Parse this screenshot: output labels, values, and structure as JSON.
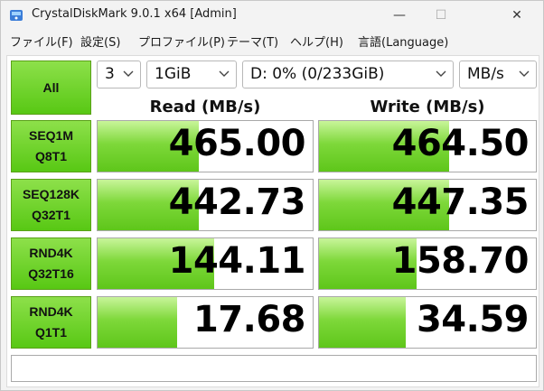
{
  "window": {
    "title": "CrystalDiskMark 9.0.1 x64 [Admin]",
    "controls": {
      "minimize": "—",
      "maximize": "☐",
      "close": "✕"
    }
  },
  "menu": [
    "ファイル(F)",
    "設定(S)",
    "プロファイル(P)",
    "テーマ(T)",
    "ヘルプ(H)",
    "言語(Language)"
  ],
  "toolbar": {
    "all_label": "All",
    "count": "3",
    "size": "1GiB",
    "drive": "D: 0% (0/233GiB)",
    "unit": "MB/s"
  },
  "headers": {
    "read": "Read (MB/s)",
    "write": "Write (MB/s)"
  },
  "tests": [
    {
      "line1": "SEQ1M",
      "line2": "Q8T1",
      "read": "465.00",
      "write": "464.50",
      "read_fill": 0.47,
      "write_fill": 0.6
    },
    {
      "line1": "SEQ128K",
      "line2": "Q32T1",
      "read": "442.73",
      "write": "447.35",
      "read_fill": 0.47,
      "write_fill": 0.6
    },
    {
      "line1": "RND4K",
      "line2": "Q32T16",
      "read": "144.11",
      "write": "158.70",
      "read_fill": 0.54,
      "write_fill": 0.45
    },
    {
      "line1": "RND4K",
      "line2": "Q1T1",
      "read": "17.68",
      "write": "34.59",
      "read_fill": 0.37,
      "write_fill": 0.4
    }
  ],
  "colors": {
    "accent_green": "#6bd023",
    "button_border": "#5aa018"
  }
}
